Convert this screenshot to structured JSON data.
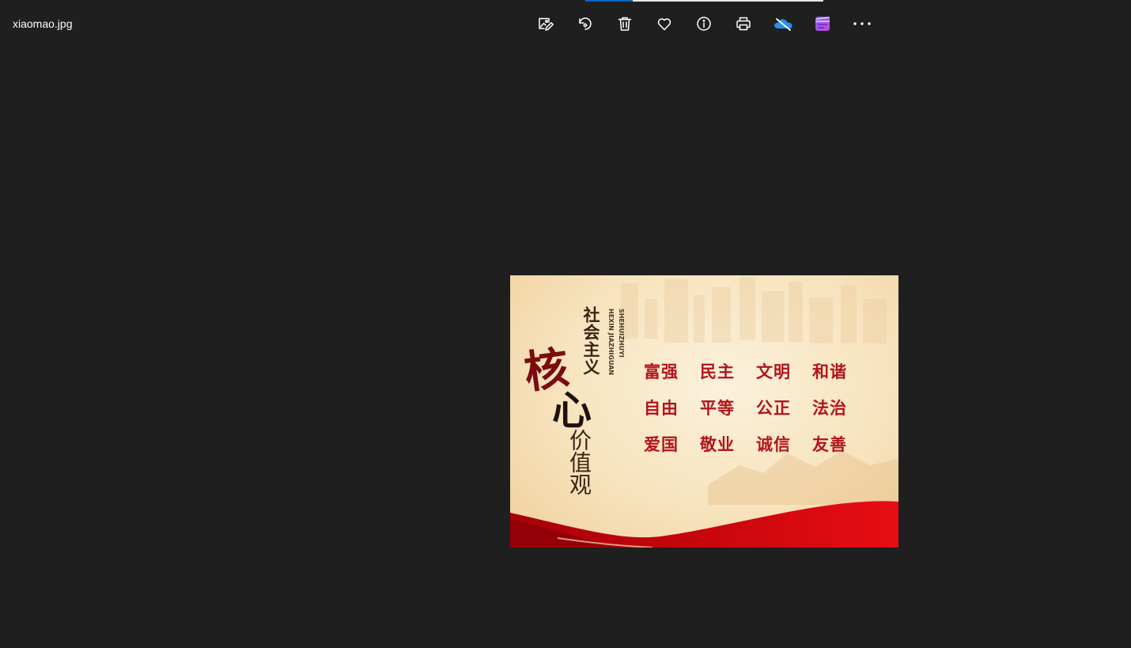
{
  "window": {
    "file_name": "xiaomao.jpg"
  },
  "loading": {
    "progress": 0.2
  },
  "toolbar": {
    "buttons": [
      {
        "name": "edit-image-button",
        "icon": "edit-image-icon"
      },
      {
        "name": "rotate-button",
        "icon": "rotate-icon"
      },
      {
        "name": "delete-button",
        "icon": "trash-icon"
      },
      {
        "name": "favorite-button",
        "icon": "heart-icon"
      },
      {
        "name": "file-info-button",
        "icon": "info-icon"
      },
      {
        "name": "print-button",
        "icon": "printer-icon"
      },
      {
        "name": "onedrive-button",
        "icon": "onedrive-cloud-off-icon"
      },
      {
        "name": "clipchamp-button",
        "icon": "clipchamp-icon"
      },
      {
        "name": "more-options-button",
        "icon": "ellipsis-icon"
      }
    ]
  },
  "photo": {
    "title_small": "社会主义",
    "pinyin_line1": "SHEHUIZHUYI",
    "pinyin_line2": "HEXIN JIAZHIGUAN",
    "title_char1": "核",
    "title_char2": "心",
    "title_tail": "价值观",
    "values": [
      "富强",
      "民主",
      "文明",
      "和谐",
      "自由",
      "平等",
      "公正",
      "法治",
      "爱国",
      "敬业",
      "诚信",
      "友善"
    ],
    "colors": {
      "value_text": "#b3141b",
      "banner_red": "#c8060d",
      "background_cream": "#f7e3bd"
    }
  }
}
